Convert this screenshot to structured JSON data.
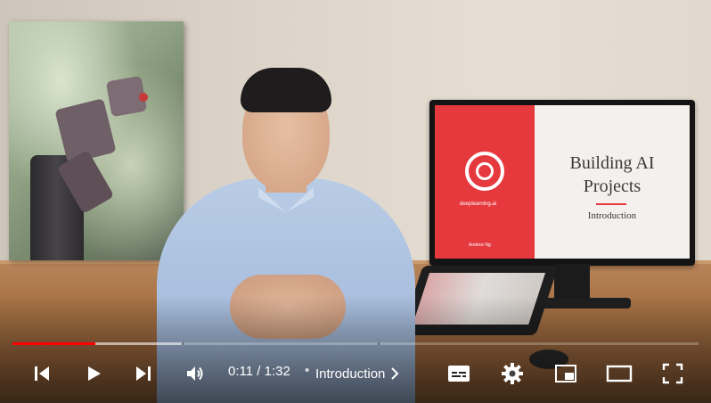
{
  "video": {
    "slide": {
      "title": "Building AI\nProjects",
      "subtitle": "Introduction",
      "brand": "deeplearning.ai",
      "credit": "Andrew Ng"
    }
  },
  "player": {
    "progress": {
      "played_fraction": 0.121,
      "buffered_fraction": 0.247,
      "chapter_marks": [
        0.247,
        0.533
      ]
    },
    "time": {
      "current": "0:11",
      "separator": " / ",
      "duration": "1:32"
    },
    "chapter": {
      "bullet": "•",
      "title": "Introduction"
    },
    "colors": {
      "progress_played": "#ff0000",
      "icons": "#ffffff"
    },
    "icons": [
      "previous-icon",
      "play-icon",
      "next-icon",
      "volume-icon",
      "chevron-right-icon",
      "subtitles-icon",
      "settings-gear-icon",
      "miniplayer-icon",
      "theater-mode-icon",
      "fullscreen-icon"
    ]
  }
}
